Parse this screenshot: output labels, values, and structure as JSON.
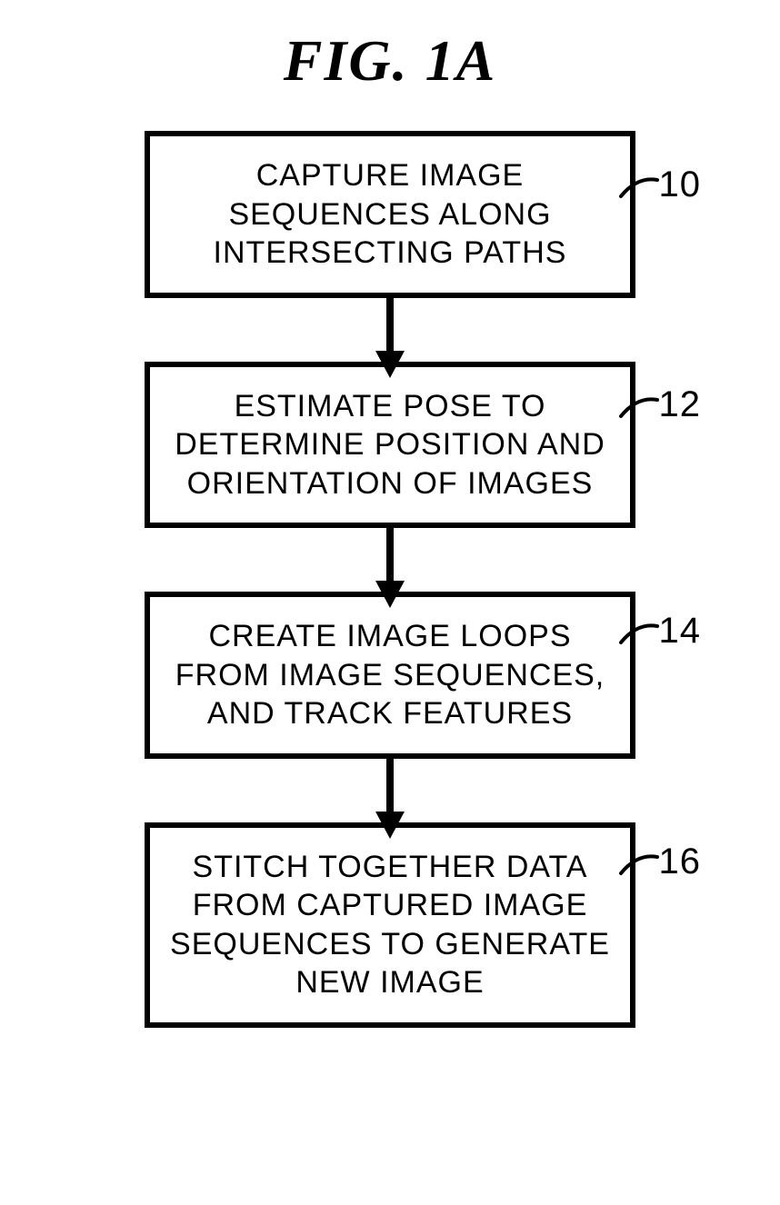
{
  "title": "FIG. 1A",
  "steps": [
    {
      "text": "CAPTURE IMAGE SEQUENCES ALONG INTERSECTING PATHS",
      "ref": "10"
    },
    {
      "text": "ESTIMATE POSE TO DETERMINE POSITION AND ORIENTATION OF IMAGES",
      "ref": "12"
    },
    {
      "text": "CREATE IMAGE LOOPS FROM IMAGE SEQUENCES, AND TRACK FEATURES",
      "ref": "14"
    },
    {
      "text": "STITCH TOGETHER DATA FROM CAPTURED IMAGE SEQUENCES TO GENERATE NEW IMAGE",
      "ref": "16"
    }
  ]
}
